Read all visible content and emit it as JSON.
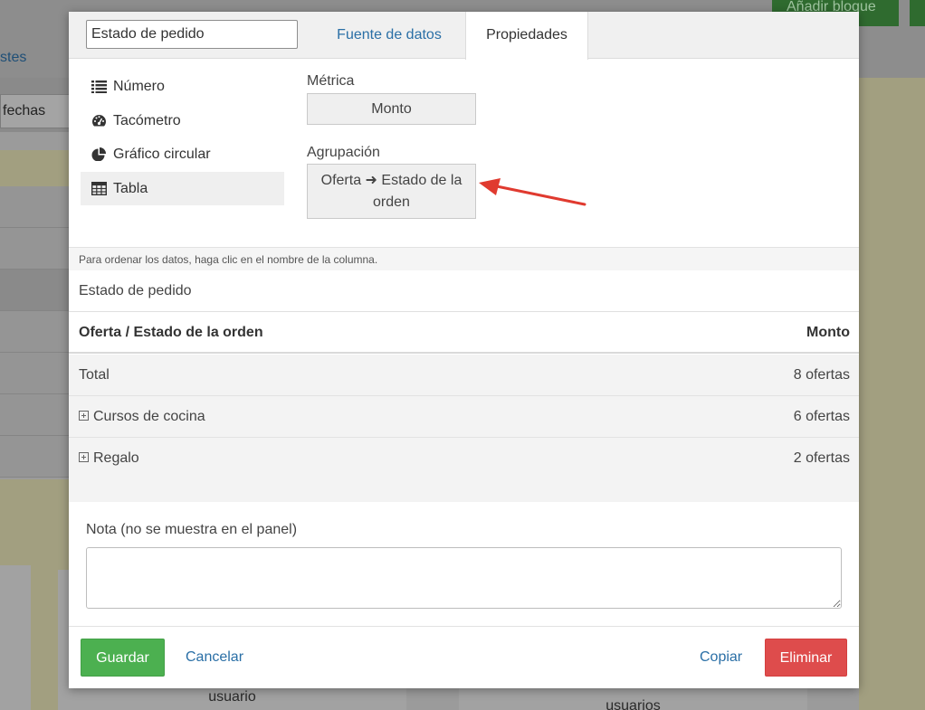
{
  "background": {
    "add_block_label": "Añadir bloque",
    "tab_partial": "stes",
    "dates_partial": "fechas",
    "card_left_label": "usuario",
    "card_right_label": "usuarios"
  },
  "modal": {
    "title_value": "Estado de pedido",
    "tabs": [
      {
        "label": "Fuente de datos"
      },
      {
        "label": "Propiedades"
      }
    ],
    "visualizations": [
      {
        "label": "Número",
        "icon": "list-icon"
      },
      {
        "label": "Tacómetro",
        "icon": "gauge-icon"
      },
      {
        "label": "Gráfico circular",
        "icon": "pie-chart-icon"
      },
      {
        "label": "Tabla",
        "icon": "table-icon"
      }
    ],
    "metric": {
      "label": "Métrica",
      "value": "Monto"
    },
    "grouping": {
      "label": "Agrupación",
      "value_line1": "Oferta ➜ Estado de la",
      "value_line2": "orden"
    },
    "hint": "Para ordenar los datos, haga clic en el nombre de la columna.",
    "table": {
      "title": "Estado de pedido",
      "columns": [
        "Oferta / Estado de la orden",
        "Monto"
      ],
      "rows": [
        {
          "name": "Total",
          "value": "8 ofertas"
        },
        {
          "name": "Cursos de cocina",
          "value": "6 ofertas"
        },
        {
          "name": "Regalo",
          "value": "2 ofertas"
        }
      ]
    },
    "note": {
      "label": "Nota (no se muestra en el panel)",
      "value": ""
    },
    "footer": {
      "save": "Guardar",
      "cancel": "Cancelar",
      "copy": "Copiar",
      "delete": "Eliminar"
    }
  },
  "colors": {
    "link": "#2a6fa6",
    "save": "#4cb050",
    "delete": "#de4c4c",
    "arrow": "#e03a2f"
  }
}
